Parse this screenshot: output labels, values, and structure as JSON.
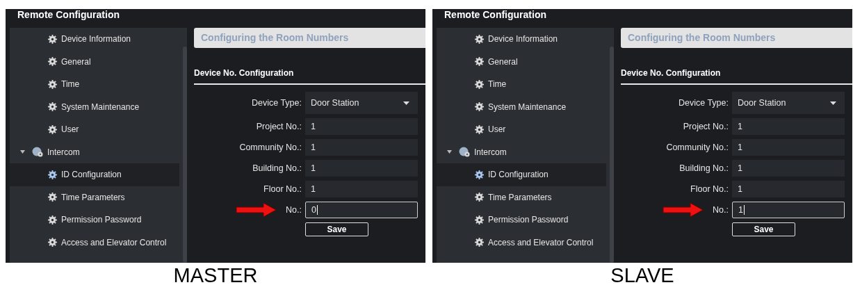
{
  "panels": [
    {
      "title": "Remote Configuration",
      "sidebar": [
        {
          "label": "Device Information",
          "selected": false
        },
        {
          "label": "General",
          "selected": false
        },
        {
          "label": "Time",
          "selected": false
        },
        {
          "label": "System Maintenance",
          "selected": false
        },
        {
          "label": "User",
          "selected": false
        },
        {
          "label": "Intercom",
          "selected": false,
          "expanded": true,
          "children": [
            {
              "label": "ID Configuration",
              "selected": true
            },
            {
              "label": "Time Parameters",
              "selected": false
            },
            {
              "label": "Permission Password",
              "selected": false
            },
            {
              "label": "Access and Elevator Control",
              "selected": false
            }
          ]
        }
      ],
      "header": "Configuring the Room Numbers",
      "section_title": "Device No. Configuration",
      "fields": [
        {
          "kind": "select",
          "label": "Device Type:",
          "value": "Door Station"
        },
        {
          "kind": "text",
          "label": "Project No.:",
          "value": "1",
          "focused": false
        },
        {
          "kind": "text",
          "label": "Community No.:",
          "value": "1",
          "focused": false
        },
        {
          "kind": "text",
          "label": "Building No.:",
          "value": "1",
          "focused": false
        },
        {
          "kind": "text",
          "label": "Floor No.:",
          "value": "1",
          "focused": false
        },
        {
          "kind": "text",
          "label": "No.:",
          "value": "0",
          "focused": true
        }
      ],
      "save_button": "Save",
      "caption": "MASTER"
    },
    {
      "title": "Remote Configuration",
      "sidebar": [
        {
          "label": "Device Information",
          "selected": false
        },
        {
          "label": "General",
          "selected": false
        },
        {
          "label": "Time",
          "selected": false
        },
        {
          "label": "System Maintenance",
          "selected": false
        },
        {
          "label": "User",
          "selected": false
        },
        {
          "label": "Intercom",
          "selected": false,
          "expanded": true,
          "children": [
            {
              "label": "ID Configuration",
              "selected": true
            },
            {
              "label": "Time Parameters",
              "selected": false
            },
            {
              "label": "Permission Password",
              "selected": false
            },
            {
              "label": "Access and Elevator Control",
              "selected": false
            }
          ]
        }
      ],
      "header": "Configuring the Room Numbers",
      "section_title": "Device No. Configuration",
      "fields": [
        {
          "kind": "select",
          "label": "Device Type:",
          "value": "Door Station"
        },
        {
          "kind": "text",
          "label": "Project No.:",
          "value": "1",
          "focused": false
        },
        {
          "kind": "text",
          "label": "Community No.:",
          "value": "1",
          "focused": false
        },
        {
          "kind": "text",
          "label": "Building No.:",
          "value": "1",
          "focused": false
        },
        {
          "kind": "text",
          "label": "Floor No.:",
          "value": "1",
          "focused": false
        },
        {
          "kind": "text",
          "label": "No.:",
          "value": "1",
          "focused": true
        }
      ],
      "save_button": "Save",
      "caption": "SLAVE"
    }
  ]
}
